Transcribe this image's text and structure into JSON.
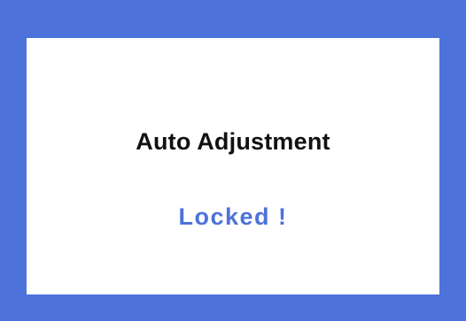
{
  "dialog": {
    "title": "Auto Adjustment",
    "status": "Locked !"
  },
  "colors": {
    "frame": "#4d72d9",
    "panel": "#ffffff",
    "title_text": "#111111",
    "status_text": "#4d72d9"
  }
}
